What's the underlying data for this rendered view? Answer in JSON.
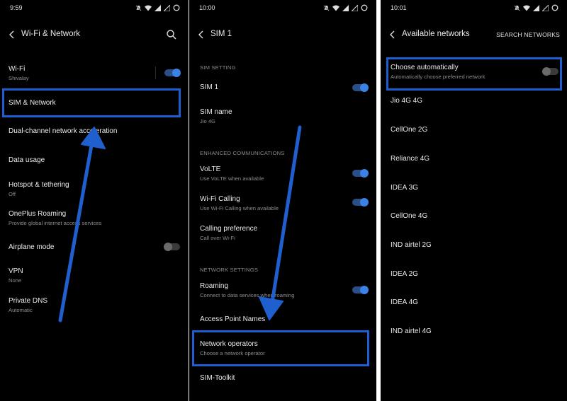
{
  "colors": {
    "accent": "#3b82e6",
    "highlight": "#1d5fd3",
    "arrow": "#1f5fce"
  },
  "screen1": {
    "time": "9:59",
    "title": "Wi-Fi & Network",
    "items": [
      {
        "title": "Wi-Fi",
        "subtitle": "Shivalay"
      },
      {
        "title": "SIM & Network",
        "subtitle": ""
      },
      {
        "title": "Dual-channel network acceleration",
        "subtitle": ""
      },
      {
        "title": "Data usage",
        "subtitle": ""
      },
      {
        "title": "Hotspot & tethering",
        "subtitle": "Off"
      },
      {
        "title": "OnePlus Roaming",
        "subtitle": "Provide global internet access services"
      },
      {
        "title": "Airplane mode",
        "subtitle": ""
      },
      {
        "title": "VPN",
        "subtitle": "None"
      },
      {
        "title": "Private DNS",
        "subtitle": "Automatic"
      }
    ]
  },
  "screen2": {
    "time": "10:00",
    "title": "SIM 1",
    "sections": {
      "sim_setting": "SIM SETTING",
      "enhanced": "ENHANCED COMMUNICATIONS",
      "network": "NETWORK SETTINGS"
    },
    "items": [
      {
        "title": "SIM 1",
        "subtitle": ""
      },
      {
        "title": "SIM name",
        "subtitle": "Jio 4G"
      },
      {
        "title": "VoLTE",
        "subtitle": "Use VoLTE when available"
      },
      {
        "title": "Wi-Fi Calling",
        "subtitle": "Use Wi-Fi Calling when available"
      },
      {
        "title": "Calling preference",
        "subtitle": "Call over Wi-Fi"
      },
      {
        "title": "Roaming",
        "subtitle": "Connect to data services when roaming"
      },
      {
        "title": "Access Point Names",
        "subtitle": ""
      },
      {
        "title": "Network operators",
        "subtitle": "Choose a network operator"
      },
      {
        "title": "SIM-Toolkit",
        "subtitle": ""
      }
    ]
  },
  "screen3": {
    "time": "10:01",
    "title": "Available networks",
    "action": "SEARCH NETWORKS",
    "auto": {
      "title": "Choose automatically",
      "subtitle": "Automatically choose preferred network"
    },
    "networks": [
      "Jio 4G 4G",
      "CellOne 2G",
      "Reliance 4G",
      "IDEA 3G",
      "CellOne 4G",
      "IND airtel 2G",
      "IDEA 2G",
      "IDEA 4G",
      "IND airtel 4G"
    ]
  }
}
